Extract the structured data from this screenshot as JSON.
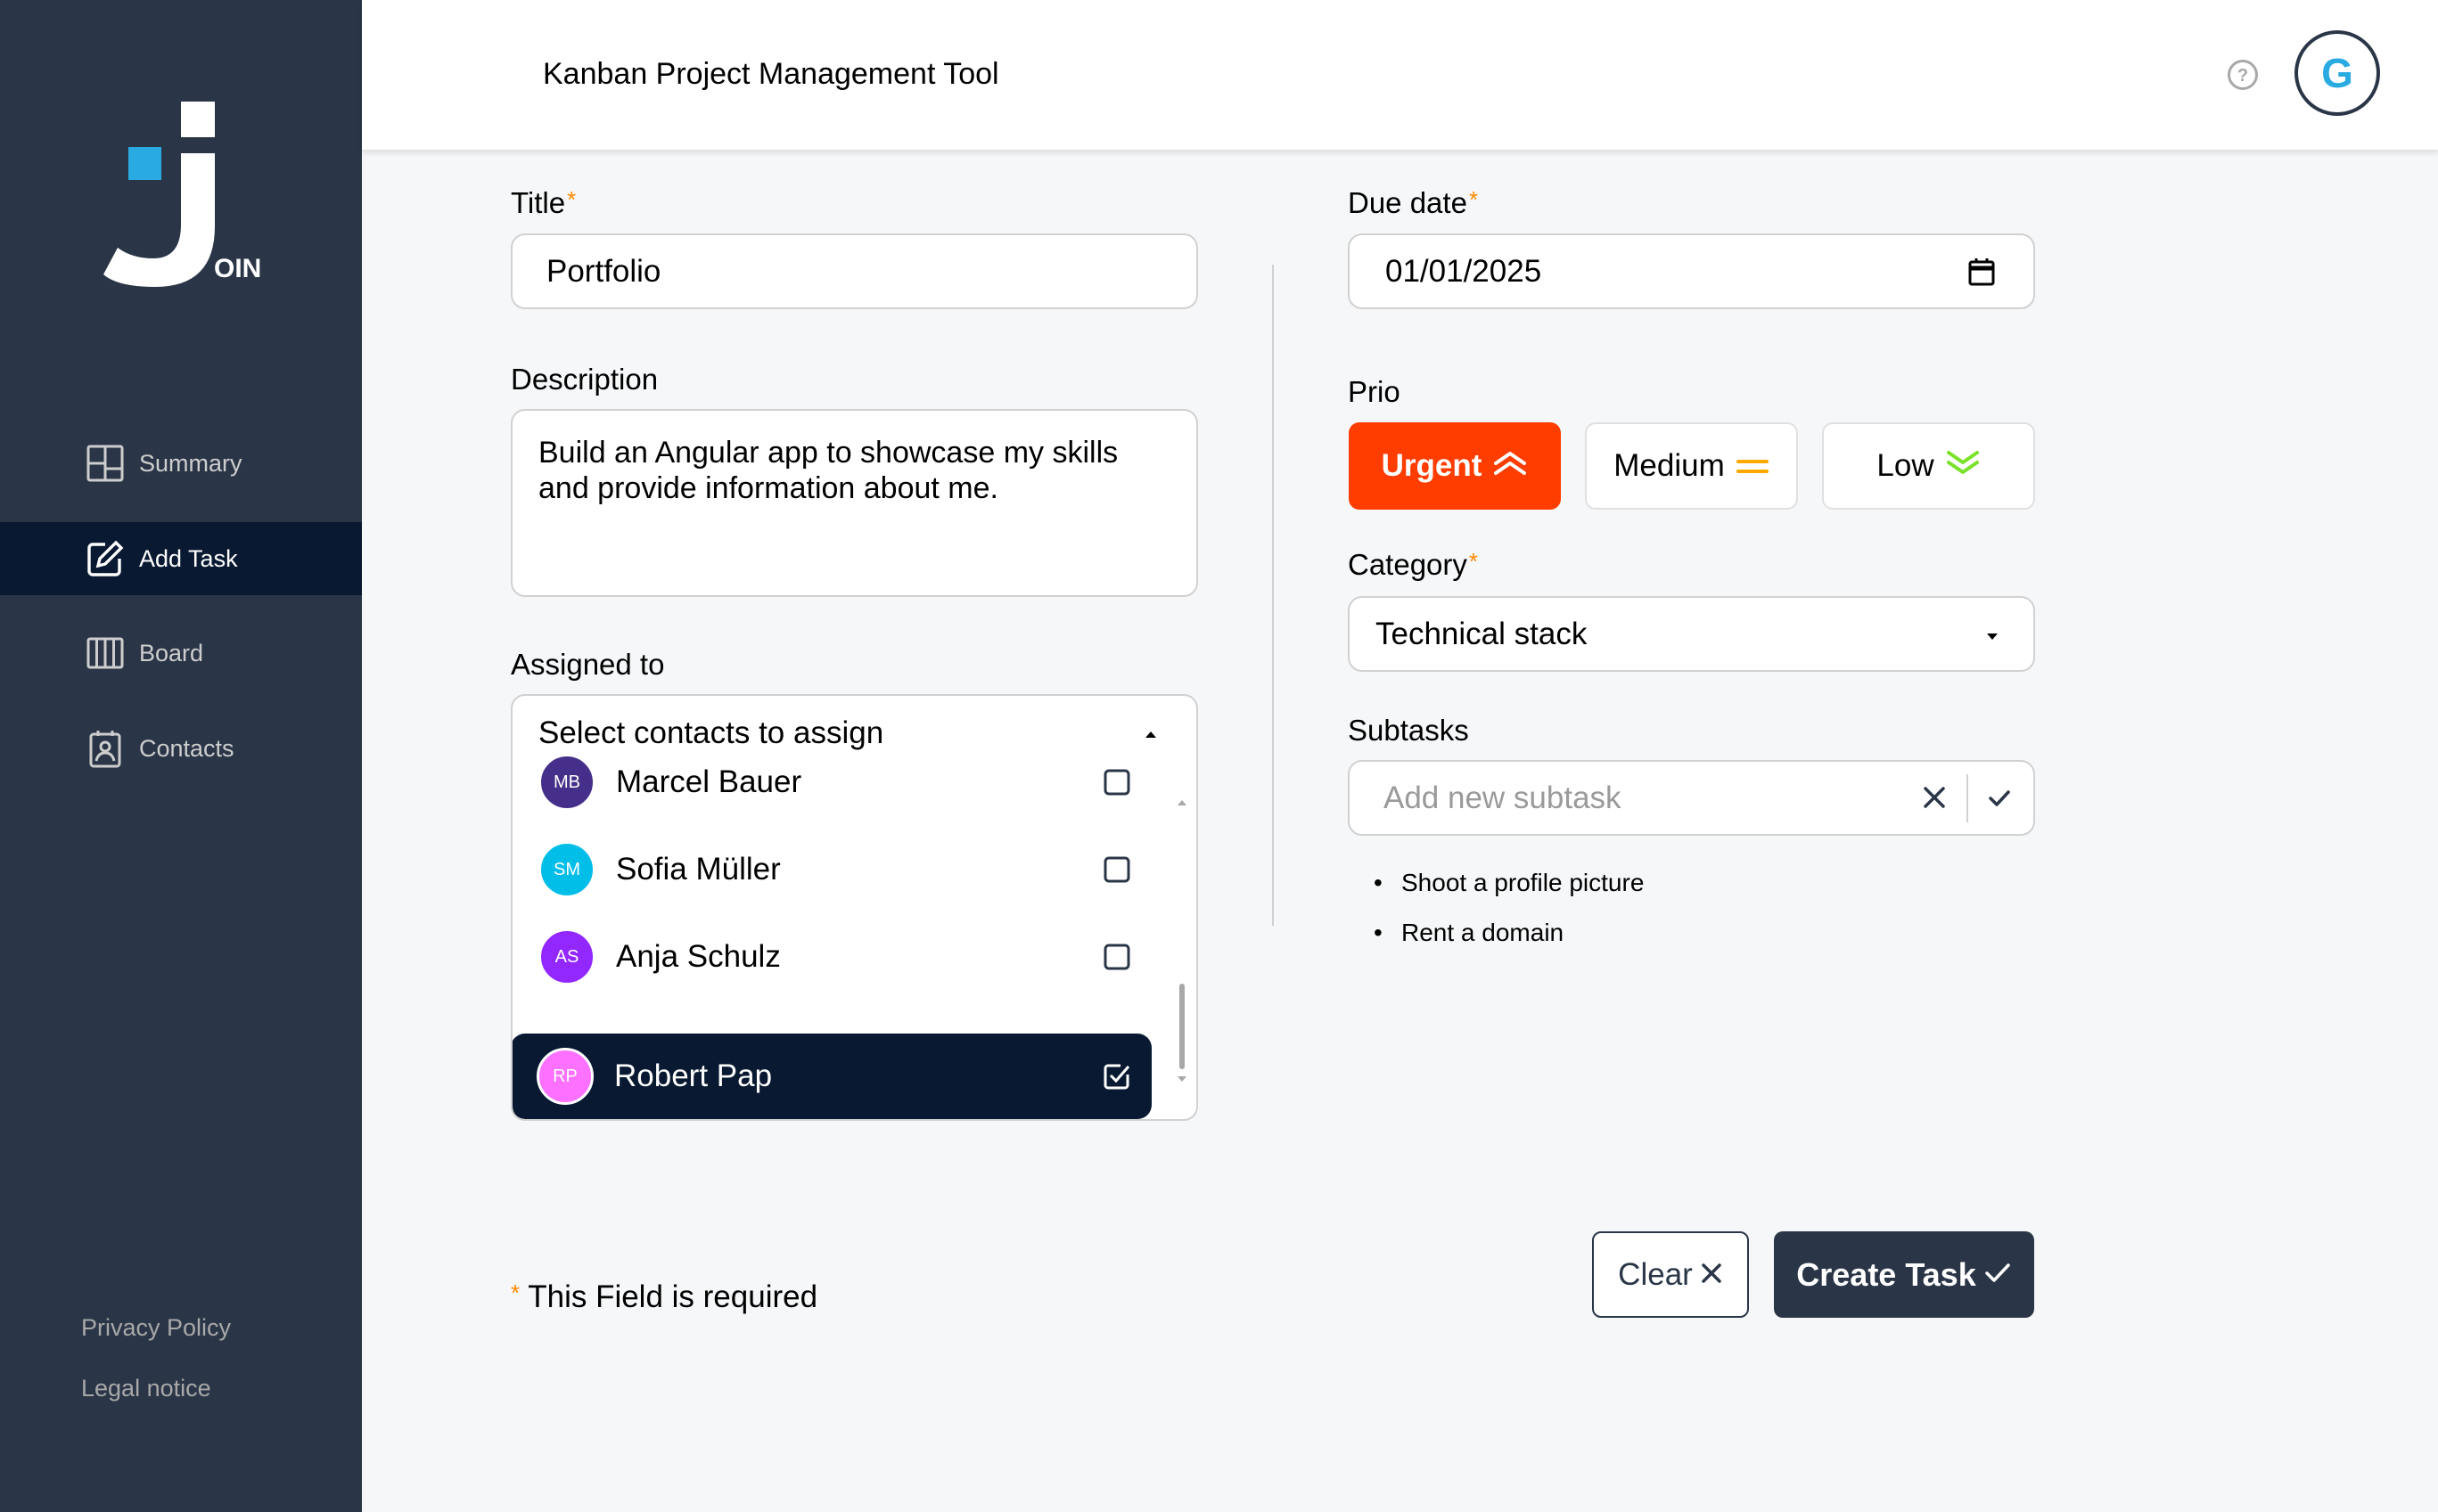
{
  "app": {
    "title": "Kanban Project Management Tool",
    "user_initial": "G",
    "logo_text": "OIN"
  },
  "sidebar": {
    "items": [
      {
        "label": "Summary",
        "icon": "summary-icon",
        "active": false
      },
      {
        "label": "Add Task",
        "icon": "edit-icon",
        "active": true
      },
      {
        "label": "Board",
        "icon": "board-icon",
        "active": false
      },
      {
        "label": "Contacts",
        "icon": "contacts-icon",
        "active": false
      }
    ],
    "footer": {
      "privacy": "Privacy Policy",
      "legal": "Legal notice"
    }
  },
  "form": {
    "title": {
      "label": "Title",
      "required": "*",
      "value": "Portfolio"
    },
    "description": {
      "label": "Description",
      "line1": "Build an Angular app to showcase my skills",
      "line2": "and provide information about me."
    },
    "assigned": {
      "label": "Assigned to",
      "placeholder": "Select contacts to assign",
      "contacts": [
        {
          "initials": "MB",
          "name": "Marcel Bauer",
          "color": "#462f8a",
          "checked": false
        },
        {
          "initials": "SM",
          "name": "Sofia Müller",
          "color": "#00bee8",
          "checked": false
        },
        {
          "initials": "AS",
          "name": "Anja Schulz",
          "color": "#9327ff",
          "checked": false
        },
        {
          "initials": "RP",
          "name": "Robert Pap",
          "color": "#fc71ff",
          "checked": true
        }
      ]
    },
    "due_date": {
      "label": "Due date",
      "required": "*",
      "value": "01/01/2025"
    },
    "prio": {
      "label": "Prio",
      "options": [
        {
          "label": "Urgent",
          "color": "#ff3d00",
          "active": true
        },
        {
          "label": "Medium",
          "color": "#ffa800",
          "active": false
        },
        {
          "label": "Low",
          "color": "#7ae229",
          "active": false
        }
      ]
    },
    "category": {
      "label": "Category",
      "required": "*",
      "value": "Technical stack"
    },
    "subtasks": {
      "label": "Subtasks",
      "placeholder": "Add new subtask",
      "items": [
        "Shoot a profile picture",
        "Rent a domain"
      ]
    },
    "required_note": {
      "asterisk": "*",
      "text": "This Field is required"
    },
    "buttons": {
      "clear": "Clear",
      "create": "Create Task"
    }
  }
}
